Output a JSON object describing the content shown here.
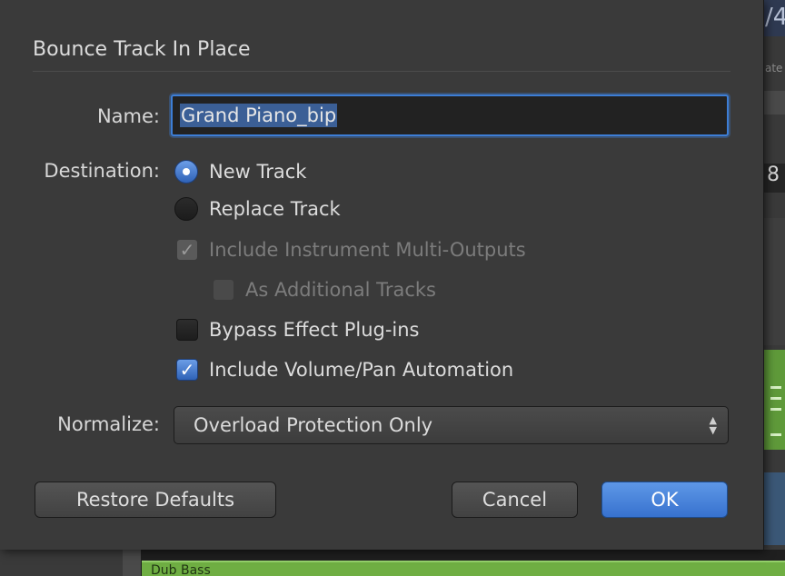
{
  "dialog": {
    "title": "Bounce Track In Place",
    "name_label": "Name:",
    "name_value": "Grand Piano_bip",
    "destination_label": "Destination:",
    "destination_options": [
      {
        "label": "New Track",
        "selected": true
      },
      {
        "label": "Replace Track",
        "selected": false
      }
    ],
    "checkboxes": {
      "include_multi_outputs": {
        "label": "Include Instrument Multi-Outputs",
        "checked": true,
        "enabled": false
      },
      "as_additional_tracks": {
        "label": "As Additional Tracks",
        "checked": false,
        "enabled": false
      },
      "bypass_effects": {
        "label": "Bypass Effect Plug-ins",
        "checked": false,
        "enabled": true
      },
      "include_volume_pan": {
        "label": "Include Volume/Pan Automation",
        "checked": true,
        "enabled": true
      }
    },
    "normalize_label": "Normalize:",
    "normalize_value": "Overload Protection Only",
    "buttons": {
      "restore_defaults": "Restore Defaults",
      "cancel": "Cancel",
      "ok": "OK"
    }
  },
  "background": {
    "region_label": "Dub Bass",
    "track_number": "8"
  },
  "colors": {
    "accent": "#3d7ed6",
    "dialog_bg": "#3a3a3a",
    "region_green": "#6fae43"
  }
}
